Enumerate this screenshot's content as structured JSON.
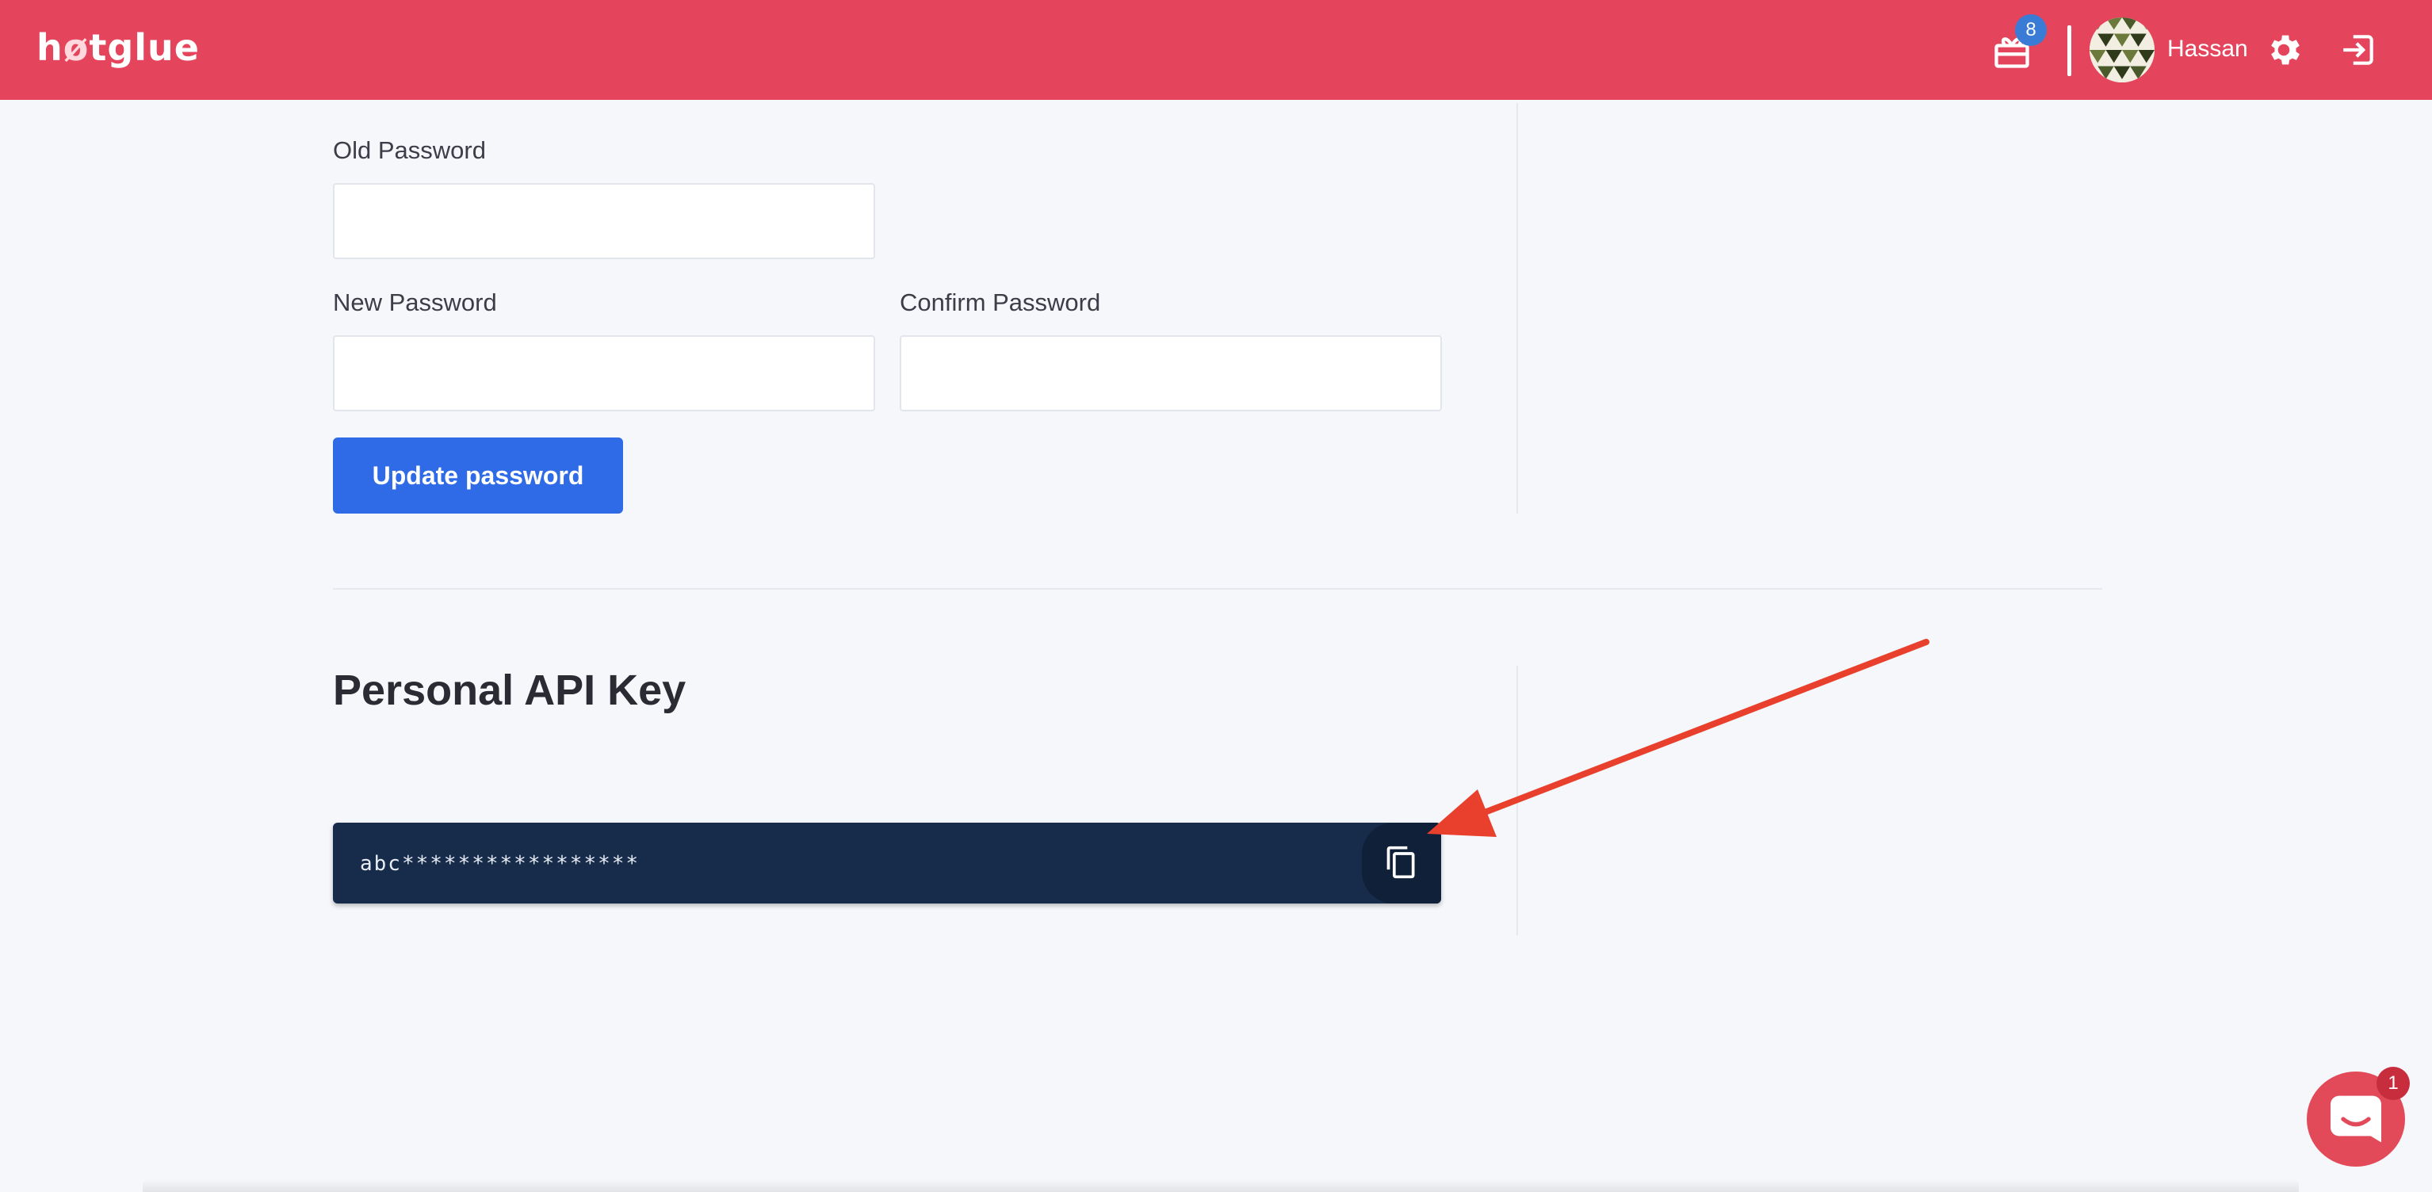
{
  "header": {
    "logo_text_pre": "h",
    "logo_text_flame": "ø",
    "logo_text_post": "tglue",
    "notifications_count": "8",
    "username": "Hassan",
    "icons": [
      "gift-icon",
      "avatar",
      "gear-icon",
      "logout-icon"
    ]
  },
  "password_form": {
    "old_password_label": "Old Password",
    "old_password_value": "",
    "new_password_label": "New Password",
    "new_password_value": "",
    "confirm_password_label": "Confirm Password",
    "confirm_password_value": "",
    "update_button_label": "Update password"
  },
  "api_key_section": {
    "title": "Personal API Key",
    "key_value": "abc*****************",
    "copy_icon": "copy-icon"
  },
  "annotation": {
    "arrow_color": "#e8402c"
  },
  "chat_widget": {
    "badge_count": "1",
    "icon": "chat-icon"
  },
  "colors": {
    "header_bg": "#e5455c",
    "primary_button": "#2f6be6",
    "api_box_bg": "#172b4a",
    "page_bg": "#f6f7fb"
  }
}
